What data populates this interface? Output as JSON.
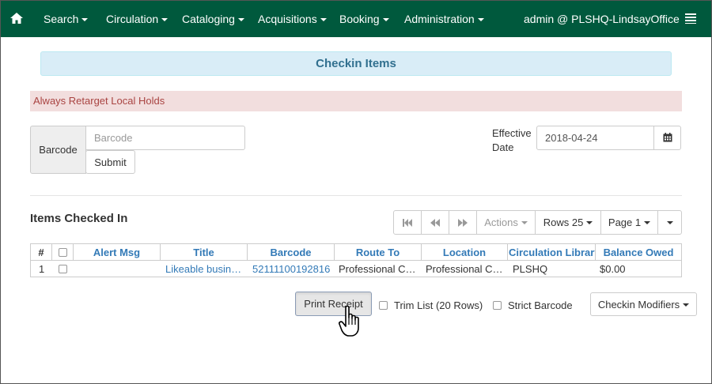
{
  "nav": {
    "items": [
      {
        "label": "Search"
      },
      {
        "label": "Circulation"
      },
      {
        "label": "Cataloging"
      },
      {
        "label": "Acquisitions"
      },
      {
        "label": "Booking"
      },
      {
        "label": "Administration"
      }
    ],
    "user": "admin @ PLSHQ-LindsayOffice",
    "brand_color": "#00593d"
  },
  "page": {
    "title": "Checkin Items",
    "alert": "Always Retarget Local Holds"
  },
  "entry": {
    "barcode_label": "Barcode",
    "barcode_placeholder": "Barcode",
    "barcode_value": "",
    "submit_label": "Submit",
    "effective_date_label": "Effective Date",
    "effective_date_value": "2018-04-24"
  },
  "grid": {
    "title": "Items Checked In",
    "toolbar": {
      "actions_label": "Actions",
      "rows_label": "Rows 25",
      "page_label": "Page 1"
    },
    "columns": [
      "#",
      "",
      "Alert Msg",
      "Title",
      "Barcode",
      "Route To",
      "Location",
      "Circulation Library",
      "Balance Owed"
    ],
    "rows": [
      {
        "index": "1",
        "alert_msg": "",
        "title": "Likeable business : why today's consumers demand more and how leaders can deliver",
        "barcode": "52111100192816",
        "route_to": "Professional Collection",
        "location": "Professional Collection",
        "circ_library": "PLSHQ",
        "balance_owed": "$0.00"
      }
    ]
  },
  "footer": {
    "print_receipt_label": "Print Receipt",
    "trim_list_label": "Trim List (20 Rows)",
    "strict_barcode_label": "Strict Barcode",
    "checkin_modifiers_label": "Checkin Modifiers"
  }
}
